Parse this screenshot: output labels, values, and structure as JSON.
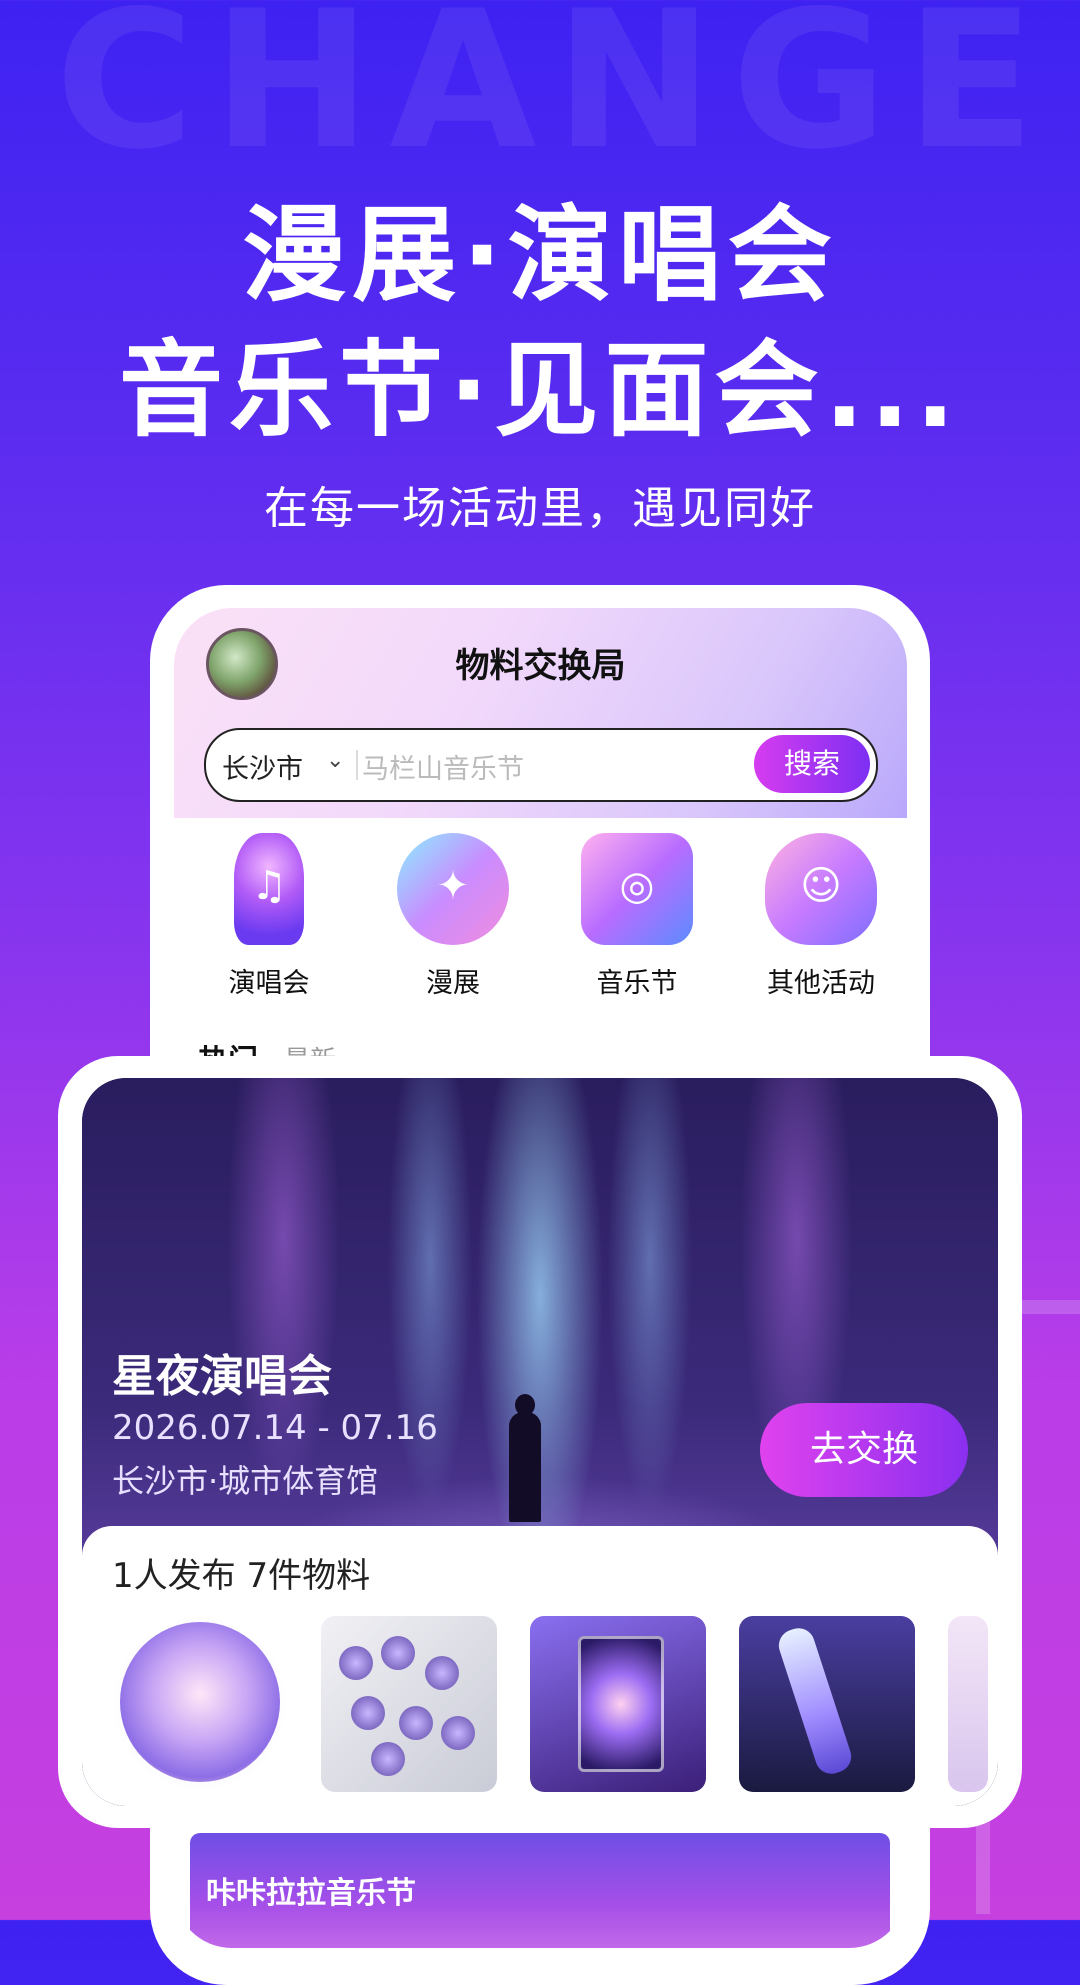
{
  "background_word": "CHANGE",
  "headline": {
    "line1": "漫展·演唱会",
    "line2": "音乐节·见面会...",
    "subtitle": "在每一场活动里，遇见同好"
  },
  "app": {
    "title": "物料交换局",
    "search": {
      "city": "长沙市",
      "placeholder": "马栏山音乐节",
      "button": "搜索"
    },
    "categories": [
      {
        "label": "演唱会",
        "icon": "microphone-icon"
      },
      {
        "label": "漫展",
        "icon": "cat-headphones-ticket-icon"
      },
      {
        "label": "音乐节",
        "icon": "dj-turntable-icon"
      },
      {
        "label": "其他活动",
        "icon": "theater-mask-icon"
      }
    ],
    "tabs": [
      "热门",
      "最新"
    ],
    "bottom_banner_title": "咔咔拉拉音乐节"
  },
  "event_card": {
    "title": "星夜演唱会",
    "date": "2026.07.14 - 07.16",
    "location": "长沙市·城市体育馆",
    "button": "去交换",
    "stats": "1人发布  7件物料",
    "thumbnails": [
      "badge-thumbnail",
      "badge-binder-thumbnail",
      "photocard-thumbnail",
      "lightstick-thumbnail",
      "partial-thumbnail"
    ]
  },
  "colors": {
    "accent_start": "#d63cf0",
    "accent_end": "#7d2ff2",
    "bg_top": "#3e22f2",
    "bg_bottom": "#c63fdf"
  }
}
